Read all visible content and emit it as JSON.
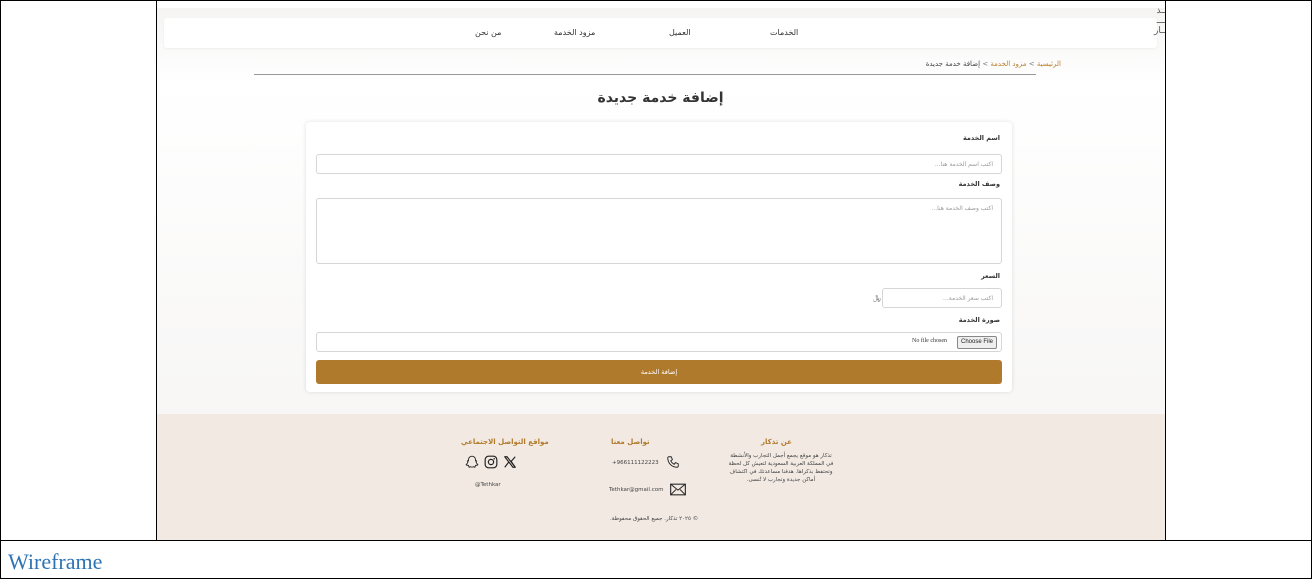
{
  "header": {
    "logo_lines": [
      "تــذ",
      "كـــ",
      "ـــار"
    ],
    "nav": [
      "الخدمات",
      "العميل",
      "مزود الخدمة",
      "من نحن"
    ]
  },
  "breadcrumb": {
    "home": "الرئيسية",
    "provider": "مزود الخدمة",
    "current": "إضافة خدمة جديدة",
    "sep": ">"
  },
  "page_title": "إضافة خدمة جديدة",
  "form": {
    "name_label": "اسم الخدمة",
    "name_placeholder": "اكتب اسم الخدمة هنا...",
    "desc_label": "وصف الخدمة",
    "desc_placeholder": "اكتب وصف الخدمة هنا...",
    "price_label": "السعر",
    "price_placeholder": "اكتب سعر الخدمة...",
    "currency": "﷼",
    "image_label": "صورة الخدمة",
    "choose_file": "Choose File",
    "no_file": "No file chosen",
    "submit": "إضافة الخدمة"
  },
  "footer": {
    "about_title": "عن تذكار",
    "about_text": "تذكار هو موقع يجمع أجمل التجارب والأنشطة في المملكة العربية السعودية لتعيش كل لحظة وتحتفظ بذكراها. هدفنا مساعدتك في اكتشاف أماكن جديدة وتجارب لا تُنسى.",
    "contact_title": "تواصل معنا",
    "phone": "+966111122223",
    "email": "Tethkar@gmail.com",
    "social_title": "مواقع التواصل الاجتماعي",
    "handle": "@Tethkar",
    "copyright": "© ٢٠٢٥ تذكار. جميع الحقوق محفوظة."
  },
  "caption": "Wireframe"
}
